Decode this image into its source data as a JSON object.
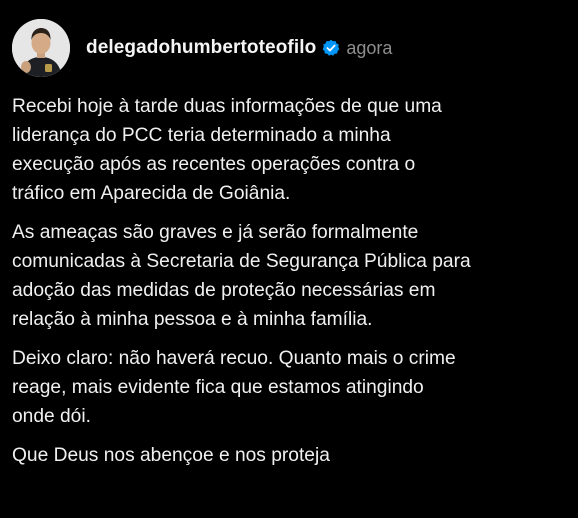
{
  "post": {
    "username": "delegadohumbertoteofilo",
    "time": "agora",
    "paragraphs": [
      "Recebi hoje à tarde duas informações de que uma\nliderança do PCC teria determinado a minha\nexecução após as recentes operações contra o\ntráfico em Aparecida de Goiânia.",
      "As ameaças são graves e já serão formalmente\ncomunicadas à Secretaria de Segurança Pública para\nadoção das medidas de proteção necessárias em\nrelação à minha pessoa e à minha família.",
      "Deixo claro: não haverá recuo. Quanto mais o crime\nreage, mais evidente fica que estamos atingindo\nonde dói.",
      "Que Deus nos abençoe e nos proteja"
    ]
  },
  "icons": {
    "avatar": "profile-photo",
    "verified": "verified-badge-icon"
  },
  "colors": {
    "background": "#000000",
    "text": "#f0f0f0",
    "muted": "#8e8e8e",
    "verified": "#0095f6"
  }
}
